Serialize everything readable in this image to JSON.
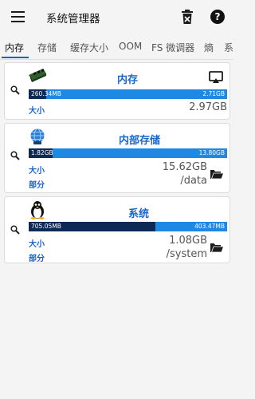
{
  "app": {
    "title": "系统管理器"
  },
  "tabs": [
    "内存",
    "存储",
    "缓存大小",
    "OOM",
    "FS 微调器",
    "熵",
    "系"
  ],
  "cards": {
    "memory": {
      "title": "内存",
      "used": "260.34MB",
      "free": "2.71GB",
      "used_fraction": 0.09,
      "size_label": "大小",
      "size_value": "2.97GB"
    },
    "internal": {
      "title": "内部存储",
      "used": "1.82GB",
      "free": "13.80GB",
      "used_fraction": 0.12,
      "size_label": "大小",
      "size_value": "15.62GB",
      "part_label": "部分",
      "part_value": "/data"
    },
    "system": {
      "title": "系统",
      "used": "705.05MB",
      "free": "403.47MB",
      "used_fraction": 0.64,
      "size_label": "大小",
      "size_value": "1.08GB",
      "part_label": "部分",
      "part_value": "/system"
    }
  },
  "icons": {
    "menu": "hamburger-menu-icon",
    "trash": "trash-icon",
    "help": "help-icon",
    "search": "magnifier-icon",
    "cast": "cast-icon",
    "folder": "folder-open-icon",
    "ram": "ram-chip-icon",
    "storage": "globe-storage-icon",
    "system": "linux-penguin-icon"
  },
  "help_glyph": "?",
  "colors": {
    "accent": "#1a66c9",
    "bar_free": "#1e88e5",
    "bar_used": "#0d2a57"
  }
}
